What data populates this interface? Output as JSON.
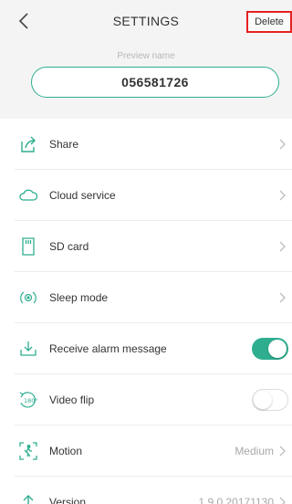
{
  "header": {
    "title": "SETTINGS",
    "delete_label": "Delete",
    "back_icon": "chevron-left-icon"
  },
  "preview": {
    "label": "Preview name",
    "value": "056581726"
  },
  "accent_color": "#2eae8f",
  "highlight_color": "#e5211f",
  "settings": {
    "items": [
      {
        "label": "Share",
        "icon": "share-icon",
        "control": "chevron"
      },
      {
        "label": "Cloud service",
        "icon": "cloud-icon",
        "control": "chevron"
      },
      {
        "label": "SD card",
        "icon": "sd-card-icon",
        "control": "chevron"
      },
      {
        "label": "Sleep mode",
        "icon": "sleep-mode-icon",
        "control": "chevron"
      },
      {
        "label": "Receive alarm message",
        "icon": "alarm-message-icon",
        "control": "toggle",
        "on": true
      },
      {
        "label": "Video flip",
        "icon": "video-flip-icon",
        "control": "toggle",
        "on": false
      },
      {
        "label": "Motion",
        "icon": "motion-icon",
        "control": "value",
        "value": "Medium"
      },
      {
        "label": "Version",
        "icon": "version-icon",
        "control": "value",
        "value": "1.9.0.20171130"
      }
    ]
  }
}
